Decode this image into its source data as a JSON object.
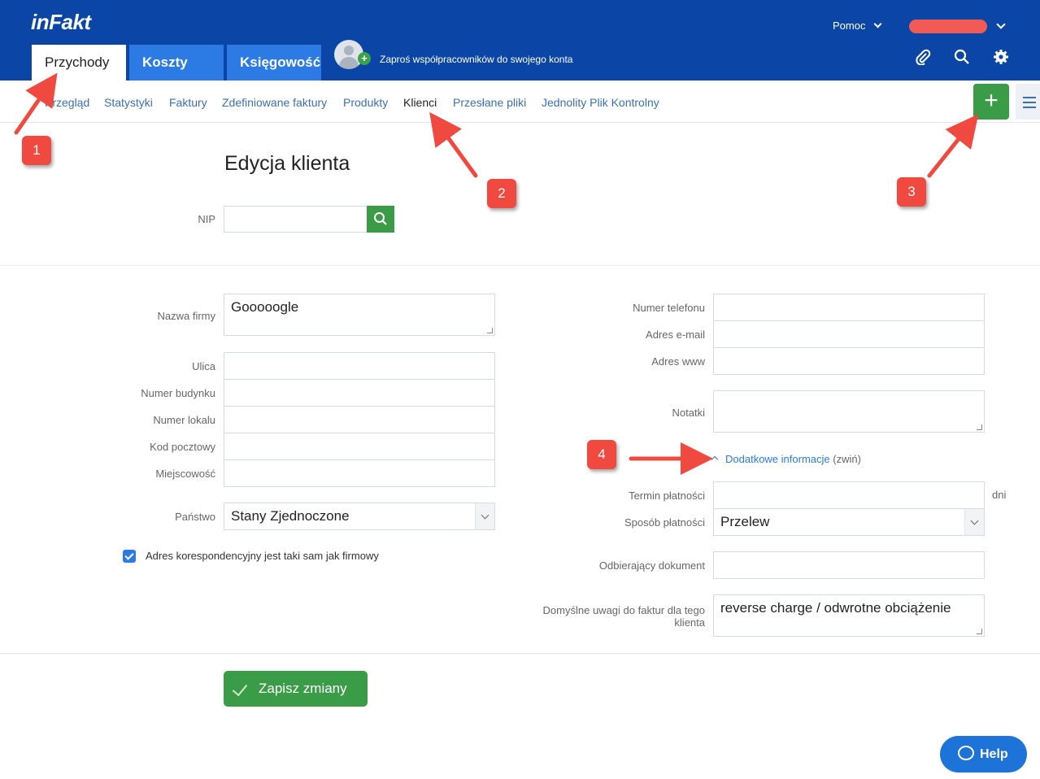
{
  "header": {
    "logo": "inFakt",
    "tabs": [
      {
        "label": "Przychody",
        "active": true
      },
      {
        "label": "Koszty",
        "active": false
      },
      {
        "label": "Księgowość",
        "active": false
      }
    ],
    "invite_text": "Zaproś współpracowników do swojego konta",
    "help_menu": "Pomoc",
    "icons": [
      "paperclip-icon",
      "search-icon",
      "gear-icon"
    ]
  },
  "subnav": {
    "items": [
      "Przegląd",
      "Statystyki",
      "Faktury",
      "Zdefiniowane faktury",
      "Produkty",
      "Klienci",
      "Przesłane pliki",
      "Jednolity Plik Kontrolny"
    ],
    "current": "Klienci",
    "add_label": "+"
  },
  "form": {
    "title": "Edycja klienta",
    "nip_label": "NIP",
    "nip_value": "",
    "company_label": "Nazwa firmy",
    "company_value": "Gooooogle",
    "street_label": "Ulica",
    "building_label": "Numer budynku",
    "unit_label": "Numer lokalu",
    "postal_label": "Kod pocztowy",
    "city_label": "Miejscowość",
    "country_label": "Państwo",
    "country_value": "Stany Zjednoczone",
    "same_address_label": "Adres korespondencyjny jest taki sam jak firmowy",
    "same_address_checked": true,
    "phone_label": "Numer telefonu",
    "email_label": "Adres e-mail",
    "www_label": "Adres www",
    "notes_label": "Notatki",
    "extra_link": "Dodatkowe informacje",
    "extra_toggle": "(zwiń)",
    "payment_term_label": "Termin płatności",
    "payment_term_unit": "dni",
    "payment_method_label": "Sposób płatności",
    "payment_method_value": "Przelew",
    "receiver_label": "Odbierający dokument",
    "remarks_label_1": "Domyślne uwagi do faktur dla tego",
    "remarks_label_2": "klienta",
    "remarks_value": "reverse charge / odwrotne obciążenie",
    "save_label": "Zapisz zmiany"
  },
  "help_widget": "Help",
  "annotations": [
    "1",
    "2",
    "3",
    "4"
  ],
  "colors": {
    "header": "#0b46a6",
    "tab_inactive": "#2c7be5",
    "primary_green": "#3a9c46",
    "annotation_red": "#f0493f"
  }
}
